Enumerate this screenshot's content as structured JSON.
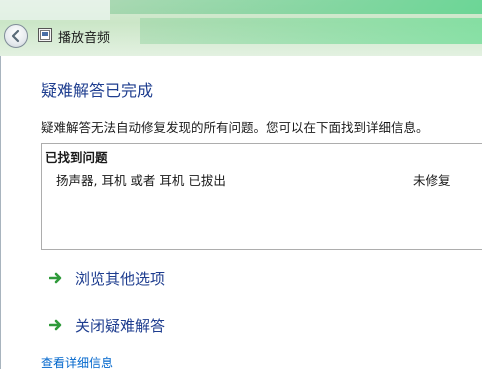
{
  "window": {
    "title": "播放音频"
  },
  "main": {
    "heading": "疑难解答已完成",
    "description": "疑难解答无法自动修复发现的所有问题。您可以在下面找到详细信息。",
    "problems": {
      "header": "已找到问题",
      "items": [
        {
          "name": "扬声器, 耳机 或者 耳机 已拔出",
          "status": "未修复"
        }
      ]
    },
    "options": [
      {
        "label": "浏览其他选项",
        "icon": "green-arrow-icon"
      },
      {
        "label": "关闭疑难解答",
        "icon": "green-arrow-icon"
      }
    ],
    "details_link": "查看详细信息"
  },
  "colors": {
    "heading": "#1e3d8f",
    "link": "#0066cc",
    "arrow": "#2f9a3a"
  }
}
